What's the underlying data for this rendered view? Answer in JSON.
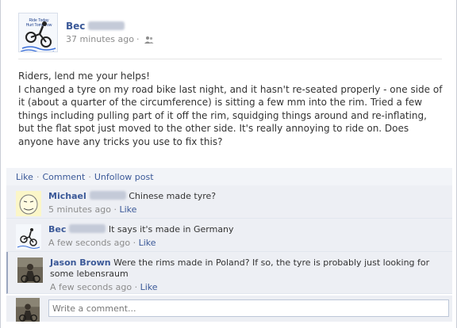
{
  "post": {
    "author_name": "Bec",
    "timestamp": "37 minutes ago",
    "separator": "·",
    "avatar_text_line1": "Ride Today",
    "avatar_text_line2": "Hurt Tomorrow",
    "body": [
      "Riders, lend me your helps!",
      "I changed a tyre on my road bike last night, and it hasn't re-seated properly - one side of it (about a quarter of the circumference) is sitting a few mm into the rim. Tried a few things including pulling part of it off the rim, squidging things around and re-inflating, but the flat spot just moved to the other side. It's really annoying to ride on. Does anyone have any tricks you use to fix this?"
    ]
  },
  "actions": {
    "like": "Like",
    "comment": "Comment",
    "unfollow": "Unfollow post",
    "separator": "·"
  },
  "comments": [
    {
      "author": "Michael",
      "text": "Chinese made tyre?",
      "time": "5 minutes ago",
      "like": "Like"
    },
    {
      "author": "Bec",
      "text": "It says it's made in Germany",
      "time": "A few seconds ago",
      "like": "Like"
    },
    {
      "author": "Jason Brown",
      "text": "Were the rims made in Poland? If so, the tyre is probably just looking for some lebensraum",
      "time": "A few seconds ago",
      "like": "Like"
    }
  ],
  "composer": {
    "placeholder": "Write a comment..."
  },
  "colors": {
    "link": "#3b5998",
    "comment_bg": "#edeff4",
    "meta_text": "#8c8c8c"
  },
  "icons": {
    "audience": "friends-icon"
  }
}
